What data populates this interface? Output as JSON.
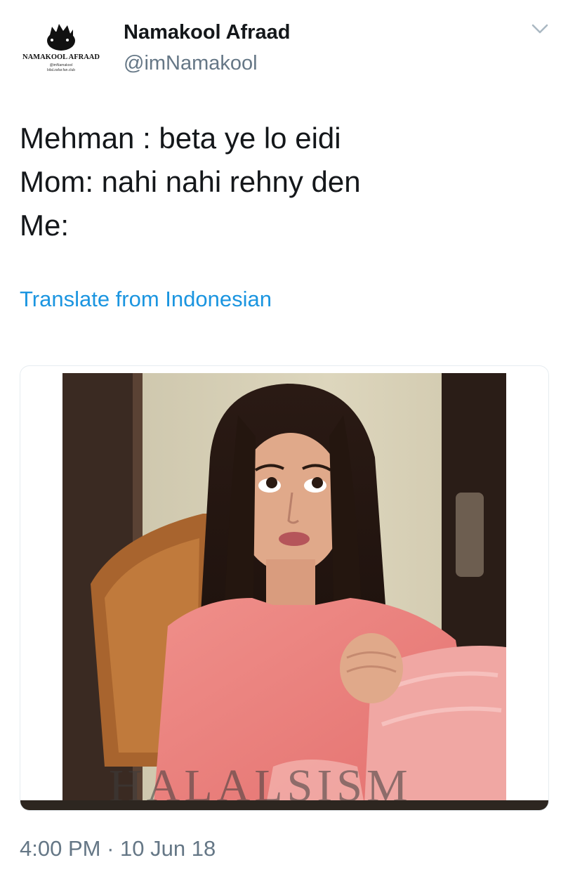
{
  "author": {
    "name": "Namakool Afraad",
    "handle": "@imNamakool",
    "avatar_text": "NAMAKOOL AFRAAD",
    "avatar_subtext_1": "@imNamakool",
    "avatar_subtext_2": "bilal.zafar.fan.club"
  },
  "tweet": {
    "lines": [
      "Mehman : beta ye lo eidi",
      "Mom: nahi nahi rehny den",
      "Me:"
    ],
    "translate_label": "Translate from Indonesian",
    "media_watermark": "HALALSISM"
  },
  "meta": {
    "time": "4:00 PM",
    "separator": "·",
    "date": "10 Jun 18"
  },
  "icons": {
    "menu": "chevron-down-icon"
  },
  "colors": {
    "name": "#14171a",
    "secondary": "#657786",
    "link": "#1b95e0",
    "border": "#e6ecf0"
  }
}
